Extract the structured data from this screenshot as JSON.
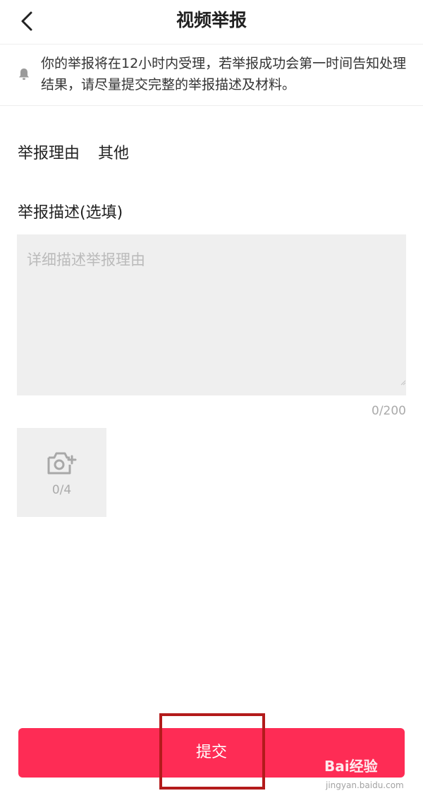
{
  "header": {
    "back_icon": "chevron-left-icon",
    "title": "视频举报"
  },
  "notice": {
    "icon": "bell-icon",
    "text": "你的举报将在12小时内受理，若举报成功会第一时间告知处理结果，请尽量提交完整的举报描述及材料。"
  },
  "reason": {
    "label": "举报理由",
    "value": "其他"
  },
  "description": {
    "label": "举报描述(选填)",
    "placeholder": "详细描述举报理由",
    "value": "",
    "counter": "0/200"
  },
  "upload": {
    "icon": "camera-add-icon",
    "count": "0/4"
  },
  "submit": {
    "label": "提交"
  },
  "watermark": {
    "main": "Bai经验",
    "sub": "jingyan.baidu.com"
  },
  "colors": {
    "accent": "#fe2c55",
    "highlight": "#b31b1b",
    "input_bg": "#efefef"
  }
}
